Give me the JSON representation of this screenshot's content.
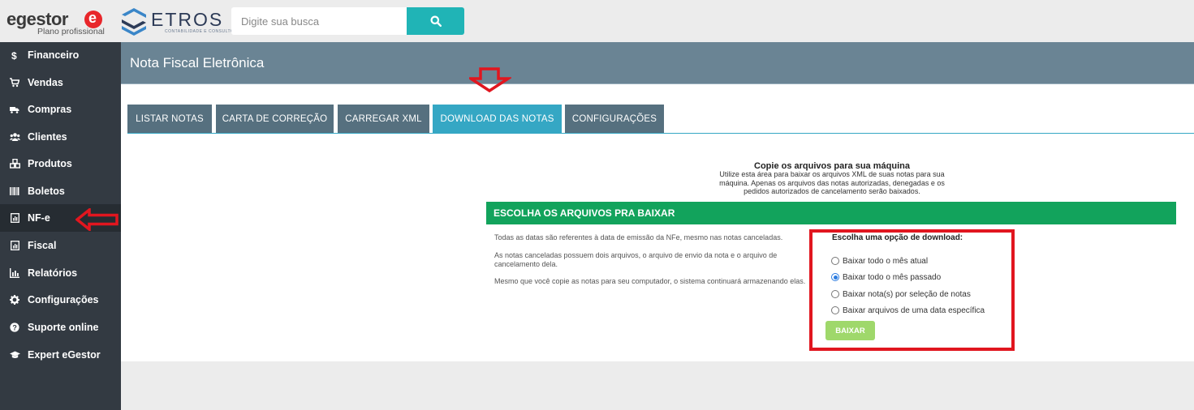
{
  "brand": {
    "egestor_word": "egestor",
    "egestor_plan": "Plano profissional",
    "etros_word": "ETROS",
    "etros_sub": "CONTABILIDADE E CONSULTORIA"
  },
  "search": {
    "placeholder": "Digite sua busca"
  },
  "sidebar": {
    "items": [
      {
        "label": "Financeiro",
        "icon": "dollar-icon"
      },
      {
        "label": "Vendas",
        "icon": "cart-icon"
      },
      {
        "label": "Compras",
        "icon": "truck-icon"
      },
      {
        "label": "Clientes",
        "icon": "users-icon"
      },
      {
        "label": "Produtos",
        "icon": "cubes-icon"
      },
      {
        "label": "Boletos",
        "icon": "barcode-icon"
      },
      {
        "label": "NF-e",
        "icon": "invoice-icon"
      },
      {
        "label": "Fiscal",
        "icon": "invoice-icon"
      },
      {
        "label": "Relatórios",
        "icon": "bar-chart-icon"
      },
      {
        "label": "Configurações",
        "icon": "gear-icon"
      },
      {
        "label": "Suporte online",
        "icon": "question-icon"
      },
      {
        "label": "Expert eGestor",
        "icon": "graduation-cap-icon"
      }
    ]
  },
  "header": {
    "title": "Nota Fiscal Eletrônica"
  },
  "tabs": [
    {
      "label": "LISTAR NOTAS"
    },
    {
      "label": "CARTA DE CORREÇÃO"
    },
    {
      "label": "CARREGAR XML"
    },
    {
      "label": "DOWNLOAD DAS NOTAS"
    },
    {
      "label": "CONFIGURAÇÕES"
    }
  ],
  "download": {
    "title": "Copie os arquivos para sua máquina",
    "description": "Utilize esta área para baixar os arquivos XML de suas notas para sua máquina. Apenas os arquivos das notas autorizadas, denegadas e os pedidos autorizados de cancelamento serão baixados.",
    "section_title": "ESCOLHA OS ARQUIVOS PRA BAIXAR",
    "notes": [
      "Todas as datas são referentes à data de emissão da NFe, mesmo nas notas canceladas.",
      "As notas canceladas possuem dois arquivos, o arquivo de envio da nota e o arquivo de cancelamento dela.",
      "Mesmo que você copie as notas para seu computador, o sistema continuará armazenando elas."
    ],
    "options_title": "Escolha uma opção de download:",
    "options": [
      {
        "label": "Baixar todo o mês atual",
        "checked": false
      },
      {
        "label": "Baixar todo o mês passado",
        "checked": true
      },
      {
        "label": "Baixar nota(s) por seleção de notas",
        "checked": false
      },
      {
        "label": "Baixar arquivos de uma data específica",
        "checked": false
      }
    ],
    "button_label": "BAIXAR"
  },
  "colors": {
    "sidebar_bg": "#333a42",
    "header_bg": "#6a8494",
    "tab_bg": "#56707f",
    "tab_active": "#35a7c4",
    "section_green": "#12a35c",
    "button_green": "#9fd86b",
    "annotation_red": "#e1161f"
  }
}
